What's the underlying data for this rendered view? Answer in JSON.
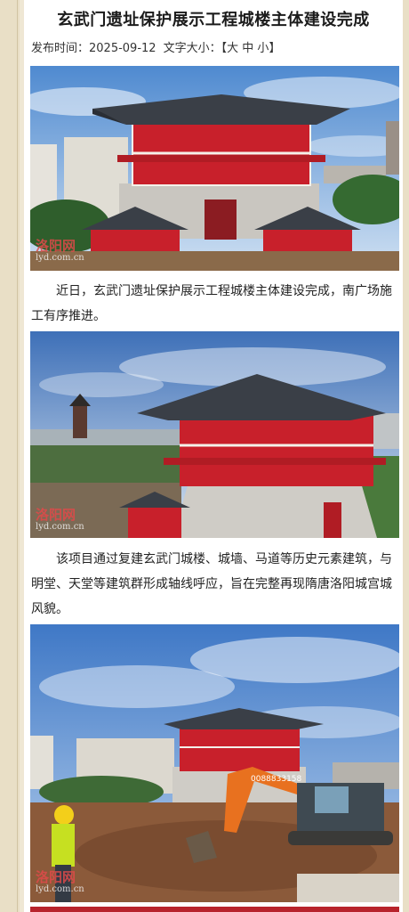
{
  "article": {
    "title": "玄武门遗址保护展示工程城楼主体建设完成",
    "publish_label": "发布时间：",
    "publish_date": "2025-09-12",
    "font_size_label": "文字大小：",
    "font_size_open": "【",
    "font_size_large": "大",
    "font_size_medium": "中",
    "font_size_small": "小",
    "font_size_close": "】",
    "paragraphs": [
      "近日，玄武门遗址保护展示工程城楼主体建设完成，南广场施工有序推进。",
      "该项目通过复建玄武门城楼、城墙、马道等历史元素建筑，与明堂、天堂等建筑群形成轴线呼应，旨在完整再现隋唐洛阳城宫城风貌。"
    ]
  },
  "watermark": {
    "logo": "洛阳网",
    "url": "lyd.com.cn"
  },
  "excavator_text": "0088833158",
  "colors": {
    "accent_red": "#c8202b",
    "roof": "#3a3f47",
    "sky": "#5d93d2"
  }
}
